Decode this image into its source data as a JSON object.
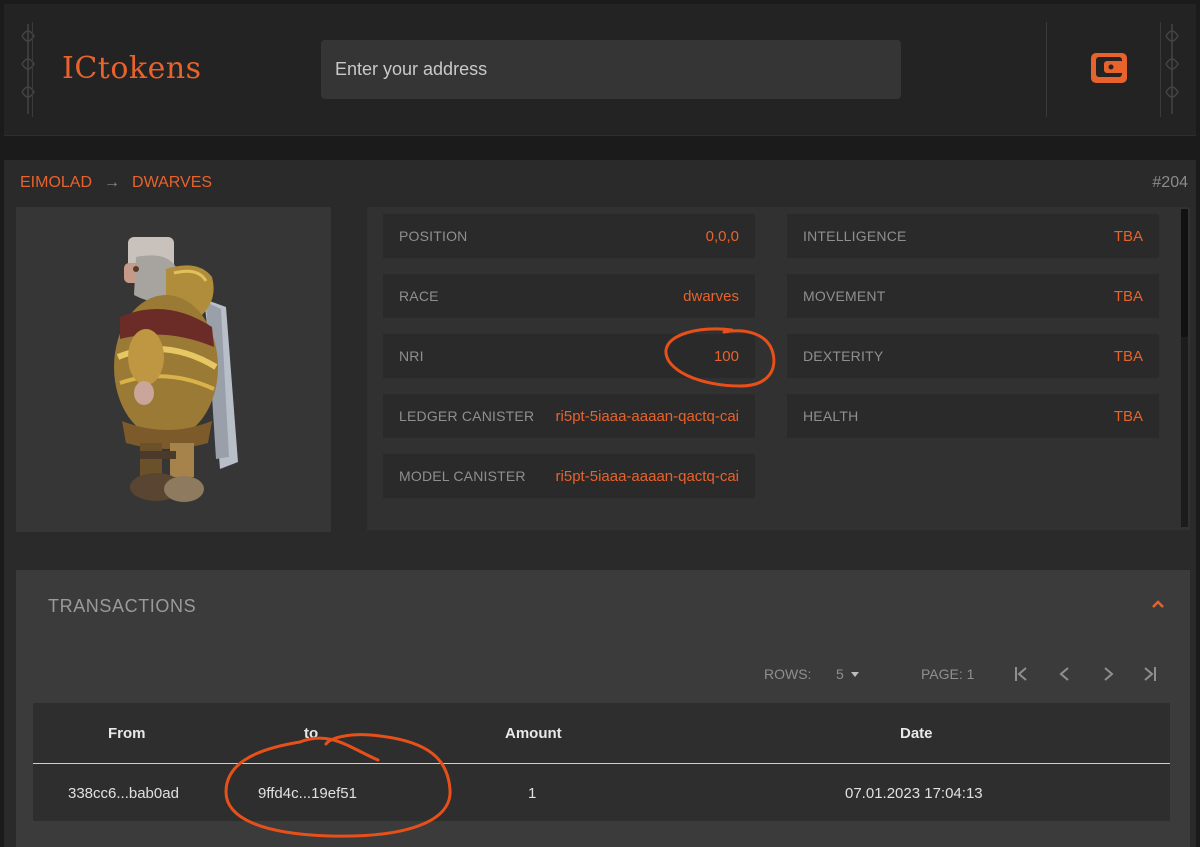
{
  "header": {
    "logo": "ICtokens",
    "search_placeholder": "Enter your address",
    "wallet_icon": "wallet-icon"
  },
  "breadcrumb": {
    "collection": "EIMOLAD",
    "separator": "→",
    "category": "DWARVES"
  },
  "token_id": "#204",
  "stats": {
    "position": {
      "label": "POSITION",
      "value": "0,0,0"
    },
    "race": {
      "label": "RACE",
      "value": "dwarves"
    },
    "nri": {
      "label": "NRI",
      "value": "100"
    },
    "ledger_canister": {
      "label": "LEDGER CANISTER",
      "value": "ri5pt-5iaaa-aaaan-qactq-cai"
    },
    "model_canister": {
      "label": "MODEL CANISTER",
      "value": "ri5pt-5iaaa-aaaan-qactq-cai"
    },
    "intelligence": {
      "label": "INTELLIGENCE",
      "value": "TBA"
    },
    "movement": {
      "label": "MOVEMENT",
      "value": "TBA"
    },
    "dexterity": {
      "label": "DEXTERITY",
      "value": "TBA"
    },
    "health": {
      "label": "HEALTH",
      "value": "TBA"
    }
  },
  "transactions": {
    "title": "TRANSACTIONS",
    "rows_label": "ROWS:",
    "rows_value": "5",
    "page_label": "PAGE: 1",
    "columns": [
      "From",
      "to",
      "Amount",
      "Date"
    ],
    "rows": [
      {
        "from": "338cc6...bab0ad",
        "to": "9ffd4c...19ef51",
        "amount": "1",
        "date": "07.01.2023 17:04:13"
      }
    ]
  },
  "colors": {
    "accent": "#e8622c",
    "annotation": "#e8501a",
    "background": "#1b1b1b",
    "panel": "#2a2a2a"
  }
}
